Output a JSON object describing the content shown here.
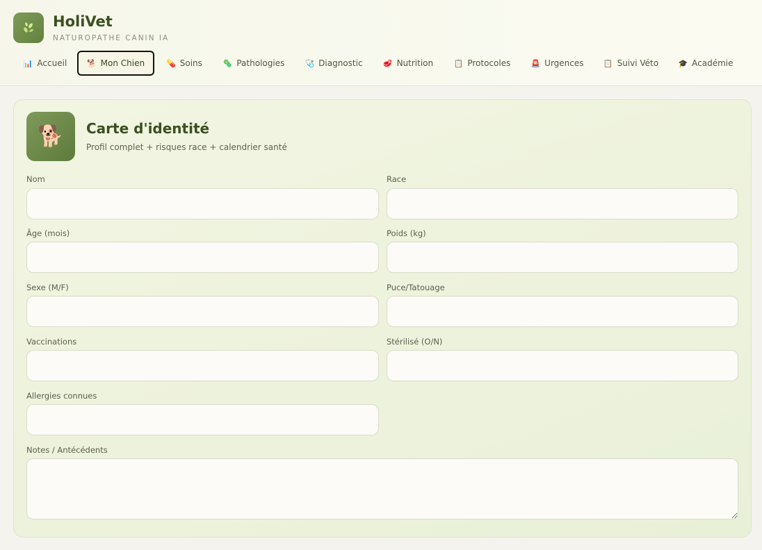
{
  "app": {
    "name": "HoliVet",
    "tagline": "NATUROPATHE CANIN IA"
  },
  "nav": {
    "tabs": [
      {
        "label": "Accueil",
        "icon": "📊"
      },
      {
        "label": "Mon Chien",
        "icon": "🐕"
      },
      {
        "label": "Soins",
        "icon": "💊"
      },
      {
        "label": "Pathologies",
        "icon": "🦠"
      },
      {
        "label": "Diagnostic",
        "icon": "🩺"
      },
      {
        "label": "Nutrition",
        "icon": "🥩"
      },
      {
        "label": "Protocoles",
        "icon": "📋"
      },
      {
        "label": "Urgences",
        "icon": "🚨"
      },
      {
        "label": "Suivi Véto",
        "icon": "📋"
      },
      {
        "label": "Académie",
        "icon": "🎓"
      }
    ],
    "active": "Mon Chien"
  },
  "card": {
    "title": "Carte d'identité",
    "subtitle": "Profil complet + risques race + calendrier santé",
    "icon": "🐕"
  },
  "form": {
    "nom": {
      "label": "Nom",
      "value": ""
    },
    "race": {
      "label": "Race",
      "value": ""
    },
    "age": {
      "label": "Âge (mois)",
      "value": ""
    },
    "poids": {
      "label": "Poids (kg)",
      "value": ""
    },
    "sexe": {
      "label": "Sexe (M/F)",
      "value": ""
    },
    "puce": {
      "label": "Puce/Tatouage",
      "value": ""
    },
    "vaccinations": {
      "label": "Vaccinations",
      "value": ""
    },
    "sterilise": {
      "label": "Stérilisé (O/N)",
      "value": ""
    },
    "allergies": {
      "label": "Allergies connues",
      "value": ""
    },
    "notes": {
      "label": "Notes / Antécédents",
      "value": ""
    }
  },
  "colors": {
    "accent": "#62813e",
    "title": "#3b5020",
    "card_bg": "#eef3de"
  }
}
